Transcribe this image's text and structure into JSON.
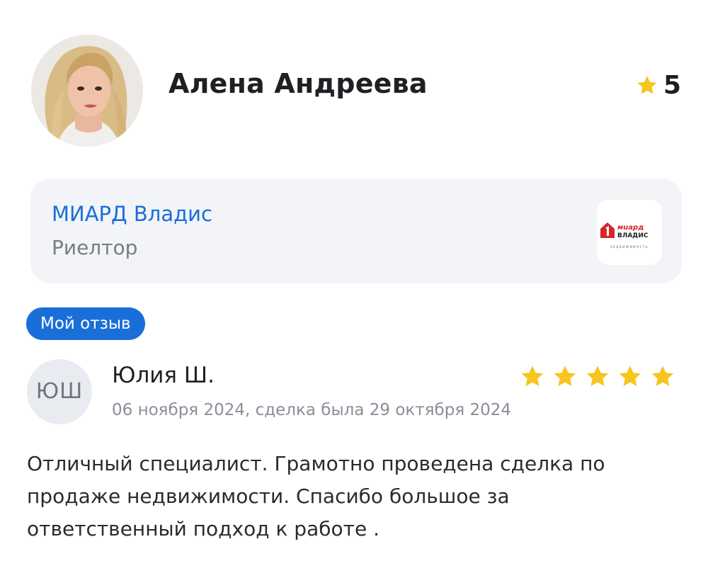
{
  "profile": {
    "name": "Алена Андреева",
    "rating": "5",
    "avatar_icon": "user-photo",
    "rating_icon": "star-icon"
  },
  "agency": {
    "name": "МИАРД Владис",
    "role": "Риелтор",
    "logo_text": "МИАРД ВЛАДИС",
    "logo_subtext": "НЕДВИЖИМОСТЬ"
  },
  "review": {
    "badge": "Мой отзыв",
    "author_initials": "ЮШ",
    "author_name": "Юлия Ш.",
    "date_line": "06 ноября 2024, сделка была 29 октября 2024",
    "stars": 5,
    "text_lines": [
      "Отличный специалист. Грамотно проведена сделка по",
      "продаже недвижимости. Спасибо большое за",
      "ответственный подход к работе ."
    ]
  },
  "colors": {
    "accent_blue": "#1a6ed8",
    "star_yellow": "#f7c51d",
    "card_bg": "#f2f4f8",
    "logo_red": "#d8242c"
  }
}
